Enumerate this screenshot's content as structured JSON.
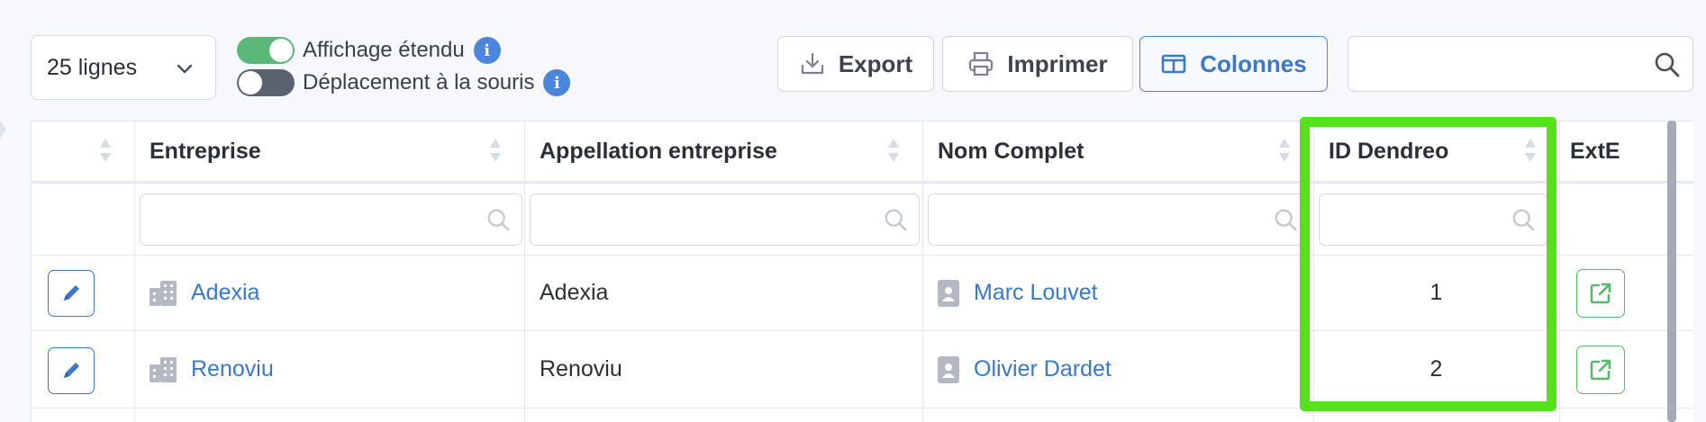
{
  "toolbar": {
    "rows_per_page": "25 lignes",
    "extended_view_label": "Affichage étendu",
    "mouse_move_label": "Déplacement à la souris",
    "export_label": "Export",
    "print_label": "Imprimer",
    "columns_label": "Colonnes",
    "search_value": "",
    "extended_view_on": true,
    "mouse_move_on": false
  },
  "table": {
    "columns": [
      "Entreprise",
      "Appellation entreprise",
      "Nom Complet",
      "ID Dendreo",
      "ExtE"
    ],
    "rows": [
      {
        "entreprise": "Adexia",
        "appellation": "Adexia",
        "nom_complet": "Marc Louvet",
        "id_dendreo": "1"
      },
      {
        "entreprise": "Renoviu",
        "appellation": "Renoviu",
        "nom_complet": "Olivier Dardet",
        "id_dendreo": "2"
      }
    ]
  },
  "icons": [
    "chevron-down-icon",
    "info-icon",
    "download-icon",
    "printer-icon",
    "columns-icon",
    "search-icon",
    "sort-icon",
    "pencil-icon",
    "building-icon",
    "contact-card-icon",
    "external-link-icon"
  ],
  "colors": {
    "accent_blue": "#3a78c9",
    "toggle_green": "#5cb87a",
    "highlight_green": "#55e21c",
    "ext_green": "#58b86e"
  }
}
